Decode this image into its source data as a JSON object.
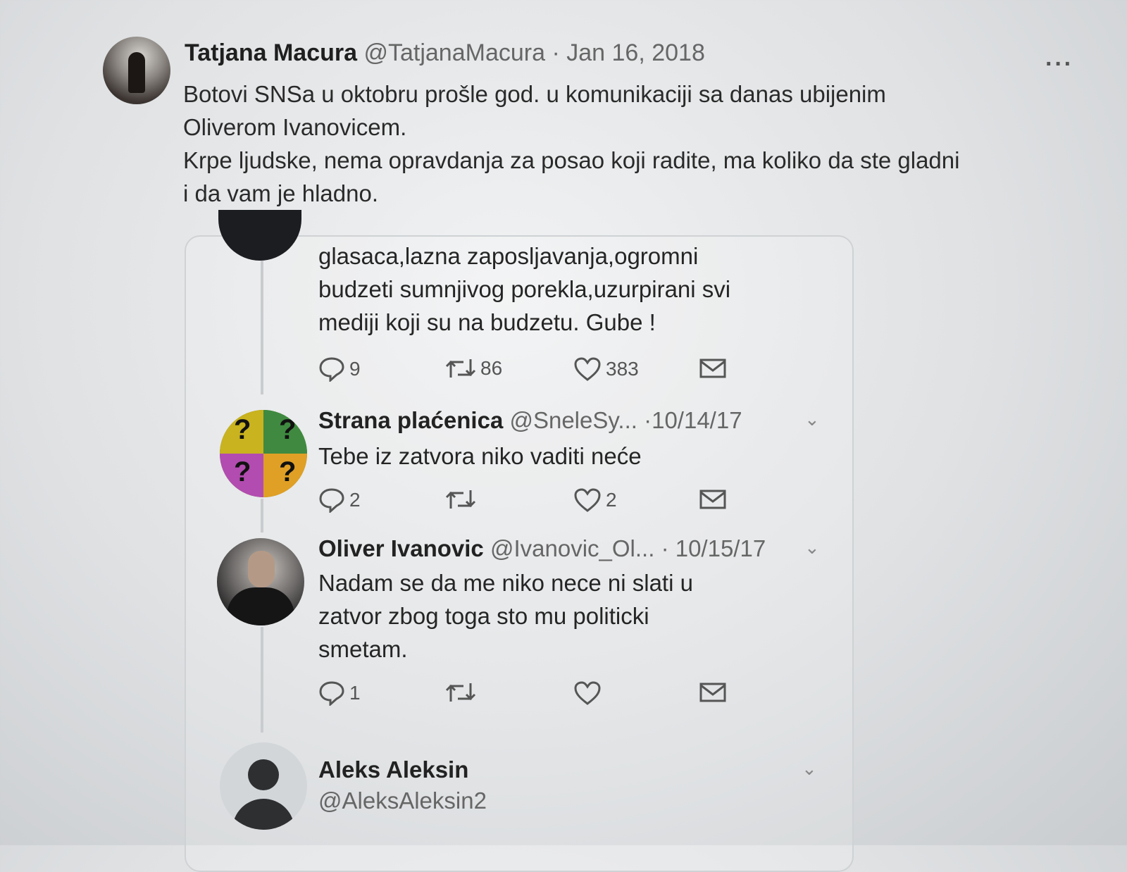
{
  "tweet": {
    "author_name": "Tatjana Macura",
    "author_handle": "@TatjanaMacura",
    "separator": "·",
    "date": "Jan 16, 2018",
    "more": "···",
    "text_line1": "Botovi SNSa u oktobru prošle god. u komunikaciji sa danas ubijenim",
    "text_line2": "Oliverom Ivanovicem.",
    "text_line3": "Krpe ljudske, nema opravdanja za posao koji radite, ma koliko da ste gladni",
    "text_line4": "i da vam je hladno."
  },
  "quote": {
    "first_reply": {
      "text_line1": "glasaca,lazna zaposljavanja,ogromni",
      "text_line2": "budzeti sumnjivog porekla,uzurpirani svi",
      "text_line3": "mediji koji su na budzetu. Gube !",
      "replies": "9",
      "retweets": "86",
      "likes": "383"
    },
    "strana": {
      "name": "Strana plaćenica",
      "handle": "@SneleSy...",
      "date": "·10/14/17",
      "text": "Tebe iz zatvora niko vaditi neće",
      "replies": "2",
      "retweets": "",
      "likes": "2",
      "avatar_marks": [
        "?",
        "?",
        "?",
        "?"
      ]
    },
    "oliver": {
      "name": "Oliver Ivanovic",
      "handle": "@Ivanovic_Ol...",
      "date": "· 10/15/17",
      "text_line1": "Nadam se da me niko nece ni slati u",
      "text_line2": "zatvor zbog toga sto mu politicki",
      "text_line3": "smetam.",
      "replies": "1",
      "retweets": "",
      "likes": ""
    },
    "aleks": {
      "name": "Aleks Aleksin",
      "handle": "@AleksAleksin2"
    },
    "chevron": "⌄"
  },
  "icons": {
    "reply": "reply-icon",
    "retweet": "retweet-icon",
    "like": "heart-icon",
    "message": "envelope-icon",
    "more": "more-icon",
    "chevron": "chevron-down-icon"
  }
}
